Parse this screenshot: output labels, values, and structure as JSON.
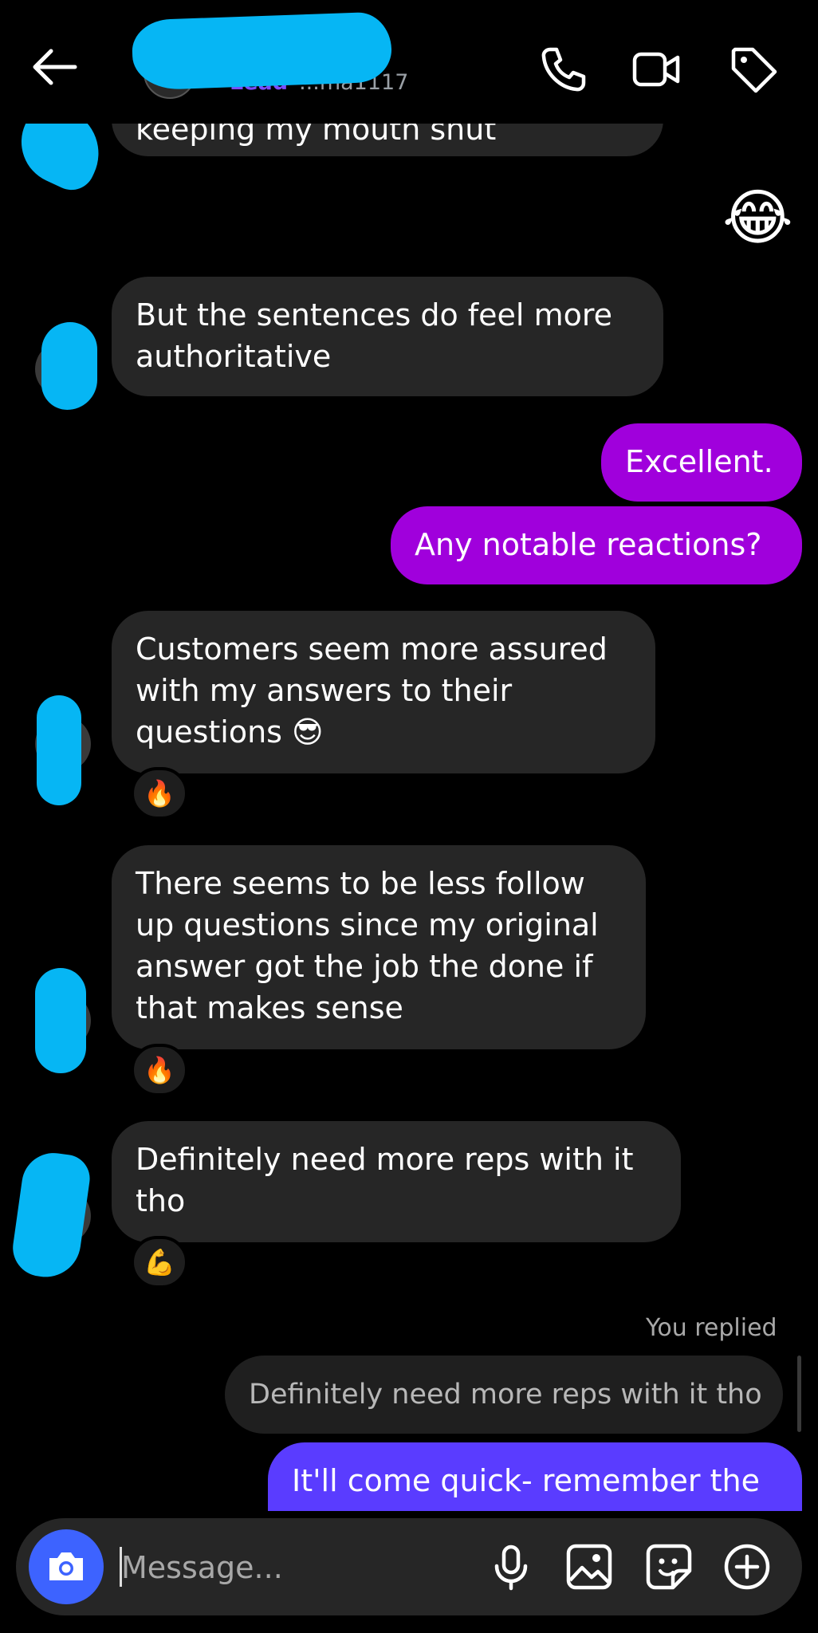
{
  "header": {
    "name_label": "Lead",
    "username": "...ma1117"
  },
  "messages": {
    "partial_top": "keeping my mouth shut",
    "laugh_emoji": "😂",
    "m1": "But the sentences do feel more authoritative",
    "m2": "Excellent.",
    "m3": "Any notable reactions?",
    "m4": "Customers seem more assured with my answers to their questions 😎",
    "m4_reaction": "🔥",
    "m5": "There seems to be less follow up questions since my original answer got the job the done if that makes sense",
    "m5_reaction": "🔥",
    "m6": "Definitely need more reps with it tho",
    "m6_reaction": "💪",
    "replied_label": "You replied",
    "reply_quote": "Definitely need more reps with it tho",
    "m7": "It'll come quick- remember the"
  },
  "composer": {
    "placeholder": "Message..."
  },
  "icons": {
    "back": "back-arrow-icon",
    "call": "phone-icon",
    "video": "video-camera-icon",
    "tag": "tag-icon",
    "camera": "camera-icon",
    "mic": "microphone-icon",
    "gallery": "image-icon",
    "sticker": "sticker-icon",
    "plus": "plus-circle-icon"
  },
  "colors": {
    "outgoing_purple": "#a000dc",
    "outgoing_blue": "#5a3cff",
    "incoming": "#262626",
    "camera_button": "#3d63ff",
    "redaction": "#06b6f4"
  }
}
